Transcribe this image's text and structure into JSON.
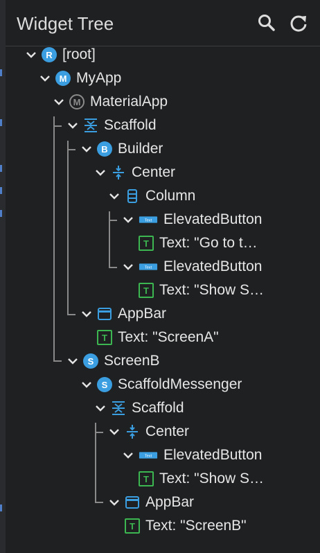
{
  "header": {
    "title": "Widget Tree",
    "search_icon": "search-icon",
    "refresh_icon": "refresh-icon"
  },
  "tree": [
    {
      "label": "[root]",
      "icon": "badge",
      "badge": "R"
    },
    {
      "label": "MyApp",
      "icon": "badge",
      "badge": "M"
    },
    {
      "label": "MaterialApp",
      "icon": "badge-grey",
      "badge": "M"
    },
    {
      "label": "Scaffold",
      "icon": "scaffold-icon"
    },
    {
      "label": "Builder",
      "icon": "badge",
      "badge": "B"
    },
    {
      "label": "Center",
      "icon": "center-icon"
    },
    {
      "label": "Column",
      "icon": "column-icon"
    },
    {
      "label": "ElevatedButton",
      "icon": "button-icon"
    },
    {
      "label": "Text: \"Go to t…",
      "icon": "text-icon"
    },
    {
      "label": "ElevatedButton",
      "icon": "button-icon"
    },
    {
      "label": "Text: \"Show S…",
      "icon": "text-icon"
    },
    {
      "label": "AppBar",
      "icon": "appbar-icon"
    },
    {
      "label": "Text: \"ScreenA\"",
      "icon": "text-icon"
    },
    {
      "label": "ScreenB",
      "icon": "badge",
      "badge": "S"
    },
    {
      "label": "ScaffoldMessenger",
      "icon": "badge",
      "badge": "S"
    },
    {
      "label": "Scaffold",
      "icon": "scaffold-icon"
    },
    {
      "label": "Center",
      "icon": "center-icon"
    },
    {
      "label": "ElevatedButton",
      "icon": "button-icon"
    },
    {
      "label": "Text: \"Show S…",
      "icon": "text-icon"
    },
    {
      "label": "AppBar",
      "icon": "appbar-icon"
    },
    {
      "label": "Text: \"ScreenB\"",
      "icon": "text-icon"
    }
  ],
  "colors": {
    "accent": "#3b9ee0",
    "text_icon": "#3cb651",
    "guide": "#8a8a8a"
  },
  "button_icon_text": "Text"
}
